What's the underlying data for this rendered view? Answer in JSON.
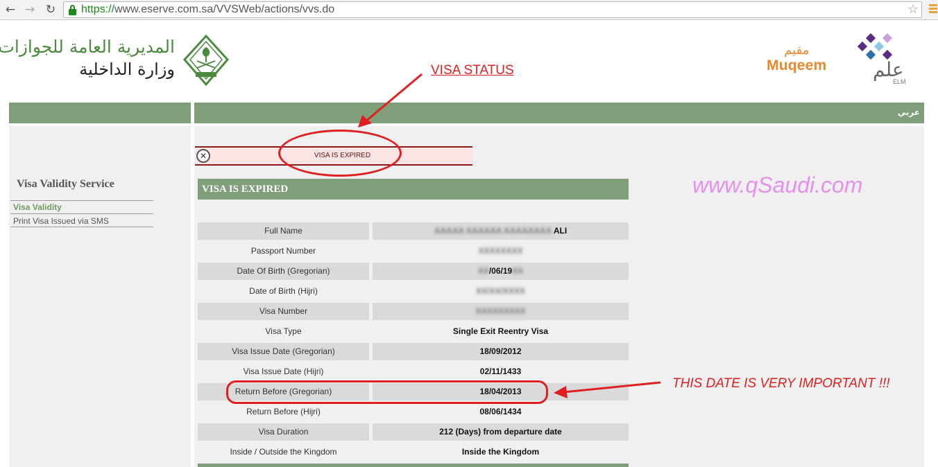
{
  "browser": {
    "url_scheme": "https://",
    "url_rest": "www.eserve.com.sa/VVSWeb/actions/vvs.do",
    "back_icon": "arrow-left-icon",
    "forward_icon": "arrow-right-icon",
    "reload_icon": "reload-icon",
    "bookmark_icon": "star-icon"
  },
  "header": {
    "arabic_line1": "المديرية العامة للجوازات",
    "arabic_line2": "وزارة الداخلية",
    "muqeem_ar": "مقيم",
    "muqeem_en": "Muqeem",
    "elm_ar": "علم",
    "elm_en": "ELM"
  },
  "annotations": {
    "visa_status": "VISA STATUS",
    "important": "THIS DATE IS VERY IMPORTANT !!!",
    "watermark": "www.qSaudi.com"
  },
  "nav": {
    "lang_link": "عربي"
  },
  "sidebar": {
    "title": "Visa Validity Service",
    "items": [
      {
        "label": "Visa Validity"
      },
      {
        "label": "Print Visa Issued via SMS"
      }
    ]
  },
  "status": {
    "message": "VISA IS EXPIRED",
    "heading": "VISA IS EXPIRED"
  },
  "details": [
    {
      "label": "Full Name",
      "value": "ALI"
    },
    {
      "label": "Passport Number",
      "value": ""
    },
    {
      "label": "Date Of Birth (Gregorian)",
      "value": "/06/19"
    },
    {
      "label": "Date of Birth (Hijri)",
      "value": ""
    },
    {
      "label": "Visa Number",
      "value": ""
    },
    {
      "label": "Visa Type",
      "value": "Single Exit Reentry Visa"
    },
    {
      "label": "Visa Issue Date (Gregorian)",
      "value": "18/09/2012"
    },
    {
      "label": "Visa Issue Date (Hijri)",
      "value": "02/11/1433"
    },
    {
      "label": "Return Before (Gregorian)",
      "value": "18/04/2013"
    },
    {
      "label": "Return Before (Hijri)",
      "value": "08/06/1434"
    },
    {
      "label": "Visa Duration",
      "value": "212 (Days) from departure date"
    },
    {
      "label": "Inside / Outside the Kingdom",
      "value": "Inside the Kingdom"
    }
  ],
  "colors": {
    "green_bar": "#7f9e79",
    "annotation_red": "#e02020",
    "watermark_pink": "#e68ff0"
  }
}
